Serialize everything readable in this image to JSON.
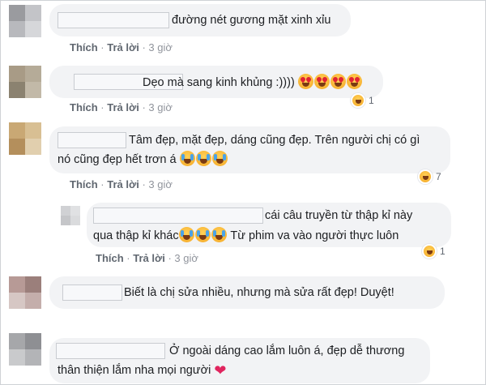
{
  "comments": [
    {
      "id": "c1",
      "text_lines": [
        "đường nét gương mặt xinh xỉu"
      ],
      "actions": {
        "like": "Thích",
        "reply": "Trả lời",
        "time": "3 giờ"
      }
    },
    {
      "id": "c2",
      "text_lines": [
        "Dẹo mà sang kinh khủng :))))"
      ],
      "emojis": [
        "heart-eyes",
        "heart-eyes",
        "heart-eyes",
        "heart-eyes"
      ],
      "reaction": {
        "icon": "haha-icon",
        "count": "1"
      },
      "actions": {
        "like": "Thích",
        "reply": "Trả lời",
        "time": "3 giờ"
      }
    },
    {
      "id": "c3",
      "text_lines": [
        "Tâm đẹp, mặt đẹp, dáng cũng đẹp. Trên người chị có gì",
        "nó cũng đẹp hết trơn á"
      ],
      "emojis": [
        "tears-of-joy",
        "tears-of-joy",
        "tears-of-joy"
      ],
      "reaction": {
        "icon": "haha-icon",
        "count": "7"
      },
      "actions": {
        "like": "Thích",
        "reply": "Trả lời",
        "time": "3 giờ"
      }
    },
    {
      "id": "r1",
      "text_lines": [
        "cái câu truyền từ thập kỉ này",
        "qua thập kỉ khác",
        "Từ phim va vào người thực luôn"
      ],
      "emojis": [
        "tears-of-joy",
        "tears-of-joy",
        "tears-of-joy"
      ],
      "reaction": {
        "icon": "haha-icon",
        "count": "1"
      },
      "actions": {
        "like": "Thích",
        "reply": "Trả lời",
        "time": "3 giờ"
      }
    },
    {
      "id": "c4",
      "text_lines": [
        "Biết là chị sửa nhiều, nhưng mà sửa rất đẹp! Duyệt!"
      ]
    },
    {
      "id": "c5",
      "text_lines": [
        "Ở ngoài dáng cao lắm luôn á, đẹp dễ thương",
        "thân thiện lắm nha mọi người"
      ],
      "emojis": [
        "red-heart"
      ]
    }
  ],
  "colors": {
    "bubble": "#f2f3f5",
    "meta": "#606770",
    "heart": "#e0245e"
  }
}
